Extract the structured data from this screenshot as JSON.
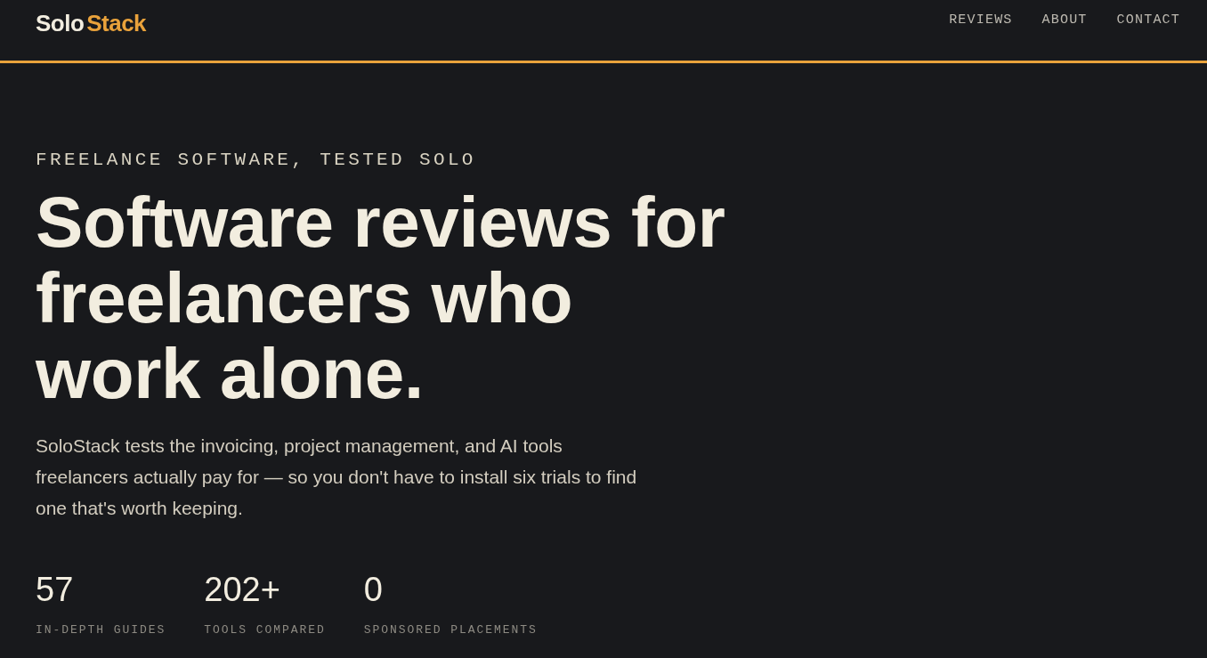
{
  "header": {
    "logo": [
      {
        "text": "Solo",
        "accent": false
      },
      {
        "text": "Stack",
        "accent": true
      }
    ],
    "nav": [
      {
        "label": "REVIEWS"
      },
      {
        "label": "ABOUT"
      },
      {
        "label": "CONTACT"
      }
    ]
  },
  "hero": {
    "eyebrow": "FREELANCE SOFTWARE, TESTED SOLO",
    "heading": "Software reviews for freelancers who work alone.",
    "description": "SoloStack tests the invoicing, project management, and AI tools freelancers actually pay for — so you don't have to install six trials to find one that's worth keeping.",
    "stats": [
      {
        "value": "57",
        "label": "IN-DEPTH GUIDES"
      },
      {
        "value": "202+",
        "label": "TOOLS COMPARED"
      },
      {
        "value": "0",
        "label": "SPONSORED PLACEMENTS"
      }
    ]
  }
}
